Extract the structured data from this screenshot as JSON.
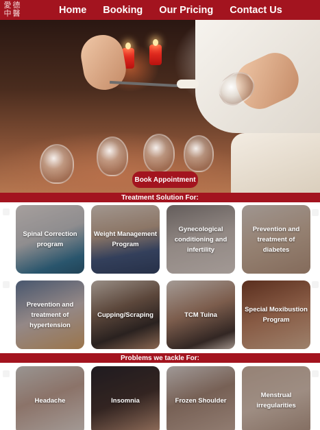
{
  "header": {
    "logo_text": "愛德中醫",
    "nav": [
      {
        "label": "Home"
      },
      {
        "label": "Booking"
      },
      {
        "label": "Our Pricing"
      },
      {
        "label": "Contact Us"
      }
    ]
  },
  "hero": {
    "cta_label": "Book Appointment"
  },
  "treatments": {
    "heading": "Treatment Solution For:",
    "items": [
      {
        "label": "Spinal Correction program"
      },
      {
        "label": "Weight Management Program"
      },
      {
        "label": "Gynecological conditioning and infertility"
      },
      {
        "label": "Prevention and treatment of diabetes"
      },
      {
        "label": "Prevention and treatment of hypertension"
      },
      {
        "label": "Cupping/Scraping"
      },
      {
        "label": "TCM Tuina"
      },
      {
        "label": "Special Moxibustion Program"
      }
    ]
  },
  "problems": {
    "heading": "Problems we tackle For:",
    "items": [
      {
        "label": "Headache"
      },
      {
        "label": "Insomnia"
      },
      {
        "label": "Frozen Shoulder"
      },
      {
        "label": "Menstrual irregularities"
      }
    ]
  },
  "colors": {
    "brand_red": "#a3141f",
    "text_on_brand": "#ffffff"
  }
}
